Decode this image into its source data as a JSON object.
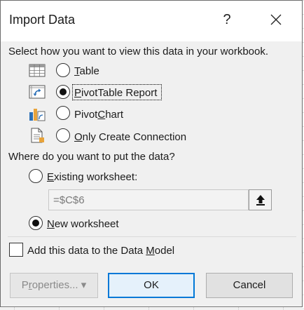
{
  "dialog": {
    "title": "Import Data",
    "help_label": "?"
  },
  "view": {
    "prompt": "Select how you want to view this data in your workbook.",
    "options": [
      {
        "pre": "",
        "key": "T",
        "post": "able",
        "icon": "table-icon",
        "selected": false
      },
      {
        "pre": "",
        "key": "P",
        "post": "ivotTable Report",
        "icon": "pivottable-icon",
        "selected": true
      },
      {
        "pre": "Pivot",
        "key": "C",
        "post": "hart",
        "icon": "pivotchart-icon",
        "selected": false
      },
      {
        "pre": "",
        "key": "O",
        "post": "nly Create Connection",
        "icon": "connection-icon",
        "selected": false
      }
    ]
  },
  "location": {
    "prompt": "Where do you want to put the data?",
    "existing": {
      "pre": "",
      "key": "E",
      "post": "xisting worksheet:",
      "selected": false
    },
    "reference_value": "=$C$6",
    "new": {
      "pre": "",
      "key": "N",
      "post": "ew worksheet",
      "selected": true
    }
  },
  "data_model": {
    "pre": "Add this data to the Data ",
    "key": "M",
    "post": "odel",
    "checked": false
  },
  "buttons": {
    "properties": {
      "pre": "P",
      "key": "r",
      "post": "operties...",
      "arrow": "▾"
    },
    "ok": "OK",
    "cancel": "Cancel"
  }
}
